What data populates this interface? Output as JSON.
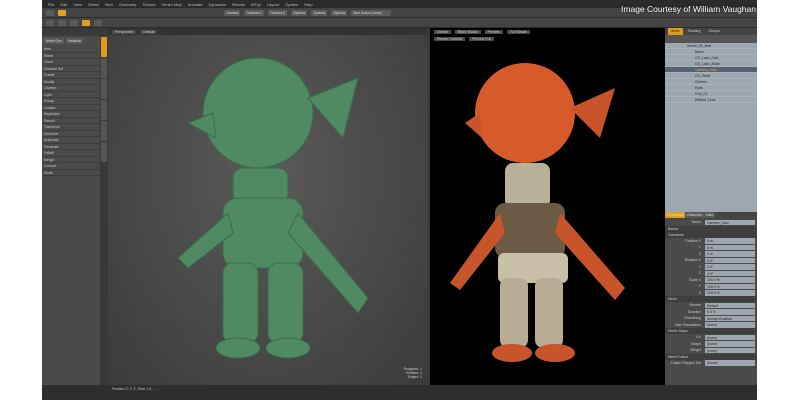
{
  "watermark": "Image Courtesy of William Vaughan",
  "menu": [
    "File",
    "Edit",
    "View",
    "Select",
    "Item",
    "Geometry",
    "Texture",
    "Vertex Map",
    "Animate",
    "Dynamics",
    "Render",
    "MTyp",
    "Layout",
    "System",
    "Help"
  ],
  "toolbar": {
    "camera_labels": [
      "Camera",
      "Camera 1",
      "Camera 2"
    ],
    "options": [
      "Options",
      "Options",
      "Options"
    ],
    "action": "Item Action (none)"
  },
  "left_panel": {
    "buttons": [
      "Mesh Ops",
      "Instance"
    ],
    "rows": [
      "Item",
      "Sheet",
      "Clone",
      "Channel Set",
      "Create",
      "Modify",
      "Camera",
      "Light",
      "Group",
      "Locator",
      "Replicator",
      "Stencil",
      "Transform",
      "Deformer",
      "Duplicate",
      "Generate",
      "Falloff",
      "Merge",
      "Convert",
      "Mode"
    ]
  },
  "left_viewport": {
    "tabs": [
      "Perspective",
      "Default"
    ],
    "info": [
      "Polygons: 1",
      "Vertices: 1",
      "Edges: 1"
    ]
  },
  "right_viewport": {
    "tabs": [
      "Default",
      "Black Studio",
      "Preview",
      "Full Shade"
    ],
    "subtabs": [
      "Render Camera",
      "Preview Full"
    ]
  },
  "items_panel": {
    "tabs": [
      "Items",
      "Shading",
      "Groups"
    ],
    "items": [
      "Scene_01_final",
      "Mesh",
      "CS_Lash_Grid",
      "CS_Lash_Ahde",
      "Camera_User",
      "CS_Teeth",
      "Clothes",
      "Eyes",
      "Grid_01",
      "Reflect_Lens"
    ],
    "selected": 4
  },
  "properties": {
    "tabs": [
      "Properties",
      "Channels",
      "Lists"
    ],
    "name_label": "Name",
    "name": "Camera_User",
    "sections": [
      "Basics",
      "Transform",
      "Mesh",
      "Vertex Maps",
      "Mesh Fusion"
    ],
    "transform": [
      [
        "Position X",
        "0 m"
      ],
      [
        "Y",
        "0 m"
      ],
      [
        "Z",
        "0 m"
      ],
      [
        "Rotation X",
        "0.0°"
      ],
      [
        "Y",
        "0.0°"
      ],
      [
        "Z",
        "0.0°"
      ],
      [
        "Scale X",
        "100.0 %"
      ],
      [
        "Y",
        "100.0 %"
      ],
      [
        "Z",
        "100.0 %"
      ]
    ],
    "mesh": [
      [
        "Render",
        "Default"
      ],
      [
        "Dissolve",
        "0.0 %"
      ],
      [
        "Smoothing",
        "Always Enabled"
      ],
      [
        "Max Tessellation",
        "(none)"
      ]
    ],
    "vmaps": [
      [
        "UV",
        "(none)"
      ],
      [
        "Morph",
        "(none)"
      ],
      [
        "Weight",
        "(none)"
      ]
    ],
    "fusion": [
      [
        "Fusion Polygon Set",
        "(None)"
      ]
    ]
  },
  "timeline": {
    "status": "Position X, Y, Z, Time 1.0, ..."
  }
}
